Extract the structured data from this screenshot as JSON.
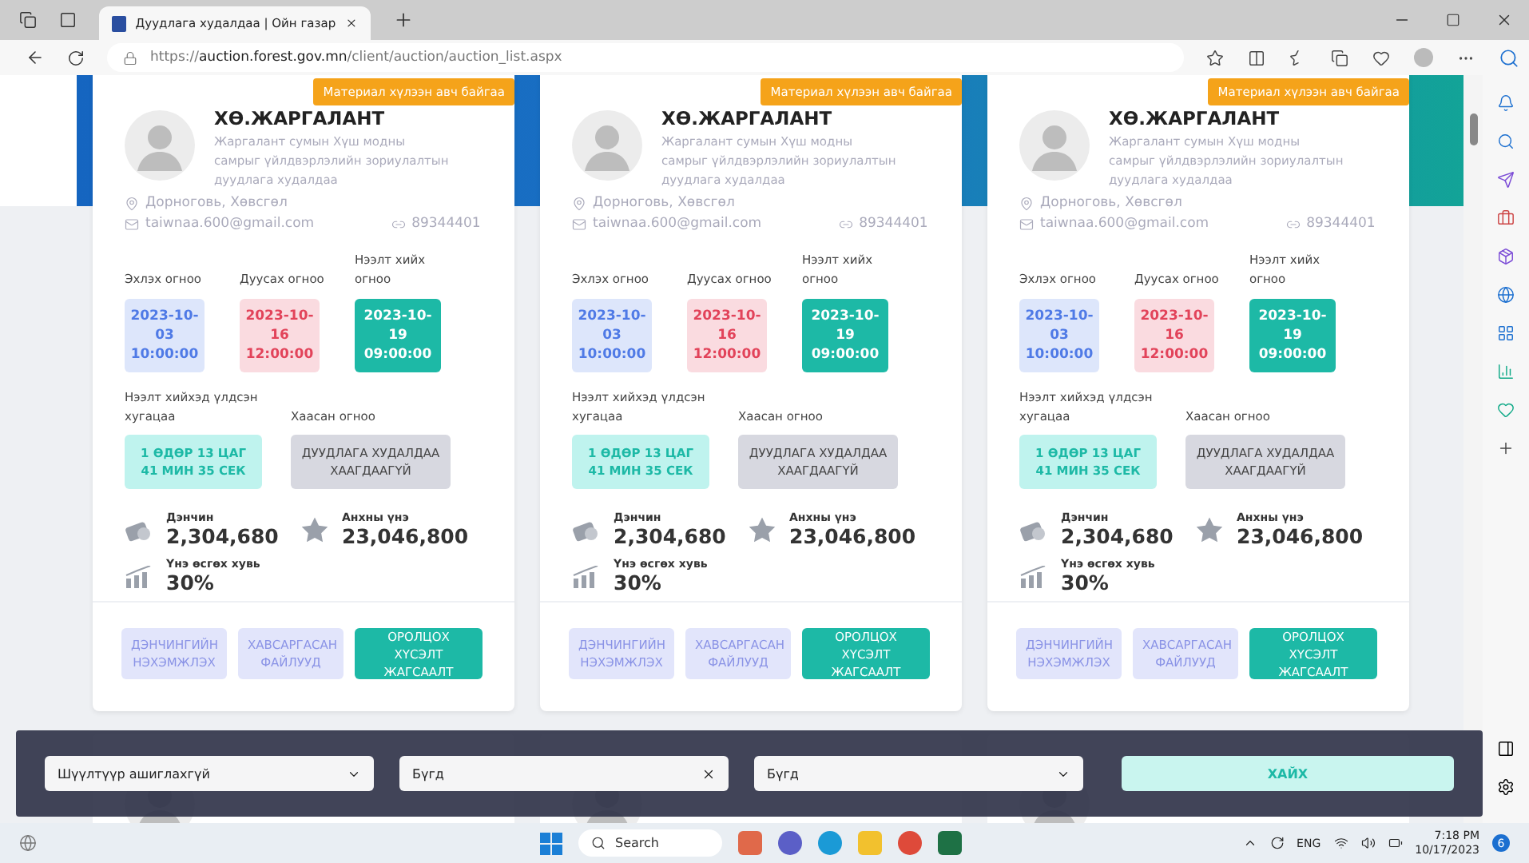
{
  "browser": {
    "tab_title": "Дуудлага худалдаа | Ойн газар",
    "url": "https://**auction.forest.gov.mn**/client/auction/auction_list.aspx"
  },
  "cards": [
    {
      "name": "ХӨ.ЖАРГАЛАНТ",
      "badge": "Материал хүлээн авч байгаа",
      "description": "Жаргалант сумын Хүш модны самрыг үйлдвэрлэлийн зориулалтын дуудлага худалдаа",
      "location": "Дорноговь, Хөвсгөл",
      "email": "taiwnaa.600@gmail.com",
      "phone": "89344401",
      "dates": [
        {
          "label": "Эхлэх огноо",
          "value": "2023-10-03 10:00:00",
          "kind": "start"
        },
        {
          "label": "Дуусах огноо",
          "value": "2023-10-16 12:00:00",
          "kind": "end"
        },
        {
          "label": "Нээлт хийх огноо",
          "value": "2023-10-19 09:00:00",
          "kind": "opening"
        }
      ],
      "remaining_label": "Нээлт хийхэд үлдсэн хугацаа",
      "remaining": "1 ӨДӨР 13 ЦАГ 41 МИН 35 СЕК",
      "closed_label": "Хаасан огноо",
      "closed": "ДУУДЛАГА ХУДАЛДАА ХААГДААГҮЙ",
      "step_label": "Дэнчин",
      "step": "2,304,680",
      "initial_label": "Анхны үнэ",
      "initial": "23,046,800",
      "increase_label": "Үнэ өсгөх хувь",
      "increase": "30%",
      "buttons": [
        {
          "label": "ДЭНЧИНГИЙН НЭХЭМЖЛЭХ",
          "kind": "soft"
        },
        {
          "label": "ХАВСАРГАСАН ФАЙЛУУД",
          "kind": "soft"
        },
        {
          "label": "ОРОЛЦОХ ХҮСЭЛТ ЖАГСААЛТ",
          "kind": "primary"
        }
      ]
    },
    {
      "name": "ХӨ.ЖАРГАЛАНТ",
      "badge": "Материал хүлээн авч байгаа",
      "description": "Жаргалант сумын Хүш модны самрыг үйлдвэрлэлийн зориулалтын дуудлага худалдаа",
      "location": "Дорноговь, Хөвсгөл",
      "email": "taiwnaa.600@gmail.com",
      "phone": "89344401",
      "dates": [
        {
          "label": "Эхлэх огноо",
          "value": "2023-10-03 10:00:00",
          "kind": "start"
        },
        {
          "label": "Дуусах огноо",
          "value": "2023-10-16 12:00:00",
          "kind": "end"
        },
        {
          "label": "Нээлт хийх огноо",
          "value": "2023-10-19 09:00:00",
          "kind": "opening"
        }
      ],
      "remaining_label": "Нээлт хийхэд үлдсэн хугацаа",
      "remaining": "1 ӨДӨР 13 ЦАГ 41 МИН 35 СЕК",
      "closed_label": "Хаасан огноо",
      "closed": "ДУУДЛАГА ХУДАЛДАА ХААГДААГҮЙ",
      "step_label": "Дэнчин",
      "step": "2,304,680",
      "initial_label": "Анхны үнэ",
      "initial": "23,046,800",
      "increase_label": "Үнэ өсгөх хувь",
      "increase": "30%",
      "buttons": [
        {
          "label": "ДЭНЧИНГИЙН НЭХЭМЖЛЭХ",
          "kind": "soft"
        },
        {
          "label": "ХАВСАРГАСАН ФАЙЛУУД",
          "kind": "soft"
        },
        {
          "label": "ОРОЛЦОХ ХҮСЭЛТ ЖАГСААЛТ",
          "kind": "primary"
        }
      ]
    },
    {
      "name": "ХӨ.ЖАРГАЛАНТ",
      "badge": "Материал хүлээн авч байгаа",
      "description": "Жаргалант сумын Хүш модны самрыг үйлдвэрлэлийн зориулалтын дуудлага худалдаа",
      "location": "Дорноговь, Хөвсгөл",
      "email": "taiwnaa.600@gmail.com",
      "phone": "89344401",
      "dates": [
        {
          "label": "Эхлэх огноо",
          "value": "2023-10-03 10:00:00",
          "kind": "start"
        },
        {
          "label": "Дуусах огноо",
          "value": "2023-10-16 12:00:00",
          "kind": "end"
        },
        {
          "label": "Нээлт хийх огноо",
          "value": "2023-10-19 09:00:00",
          "kind": "opening"
        }
      ],
      "remaining_label": "Нээлт хийхэд үлдсэн хугацаа",
      "remaining": "1 ӨДӨР 13 ЦАГ 41 МИН 35 СЕК",
      "closed_label": "Хаасан огноо",
      "closed": "ДУУДЛАГА ХУДАЛДАА ХААГДААГҮЙ",
      "step_label": "Дэнчин",
      "step": "2,304,680",
      "initial_label": "Анхны үнэ",
      "initial": "23,046,800",
      "increase_label": "Үнэ өсгөх хувь",
      "increase": "30%",
      "buttons": [
        {
          "label": "ДЭНЧИНГИЙН НЭХЭМЖЛЭХ",
          "kind": "soft"
        },
        {
          "label": "ХАВСАРГАСАН ФАЙЛУУД",
          "kind": "soft"
        },
        {
          "label": "ОРОЛЦОХ ХҮСЭЛТ ЖАГСААЛТ",
          "kind": "primary"
        }
      ]
    }
  ],
  "filter": {
    "fields": [
      {
        "kind": "select",
        "value": "Шүүлтүүр ашиглахгүй"
      },
      {
        "kind": "clearable",
        "value": "Бүгд"
      },
      {
        "kind": "select",
        "value": "Бүгд"
      }
    ],
    "search_button": "ХАЙХ"
  },
  "taskbar": {
    "search": "Search",
    "language": "ENG",
    "time": "7:18 PM",
    "date": "10/17/2023",
    "notifications": "6"
  }
}
